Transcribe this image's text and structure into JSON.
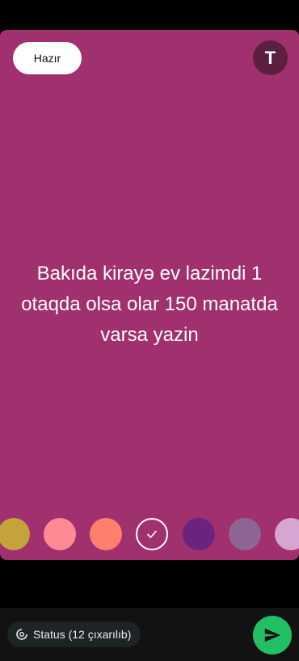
{
  "editor": {
    "done_label": "Hazır",
    "font_button_label": "T",
    "status_text": "Bakıda kirayə ev lazimdi 1 otaqda olsa olar 150 manatda varsa yazin",
    "background_color": "#a0306e"
  },
  "palette": {
    "colors": [
      "#c3a33a",
      "#ff8a96",
      "#ff7f6e",
      "#a0306e",
      "#6a237f",
      "#8f6594",
      "#d7a5d2"
    ],
    "selected_index": 3
  },
  "bottom_bar": {
    "privacy_label": "Status (12 çıxarılıb)",
    "privacy_icon": "status-icon",
    "send_icon": "send-icon",
    "send_color": "#21c063"
  }
}
